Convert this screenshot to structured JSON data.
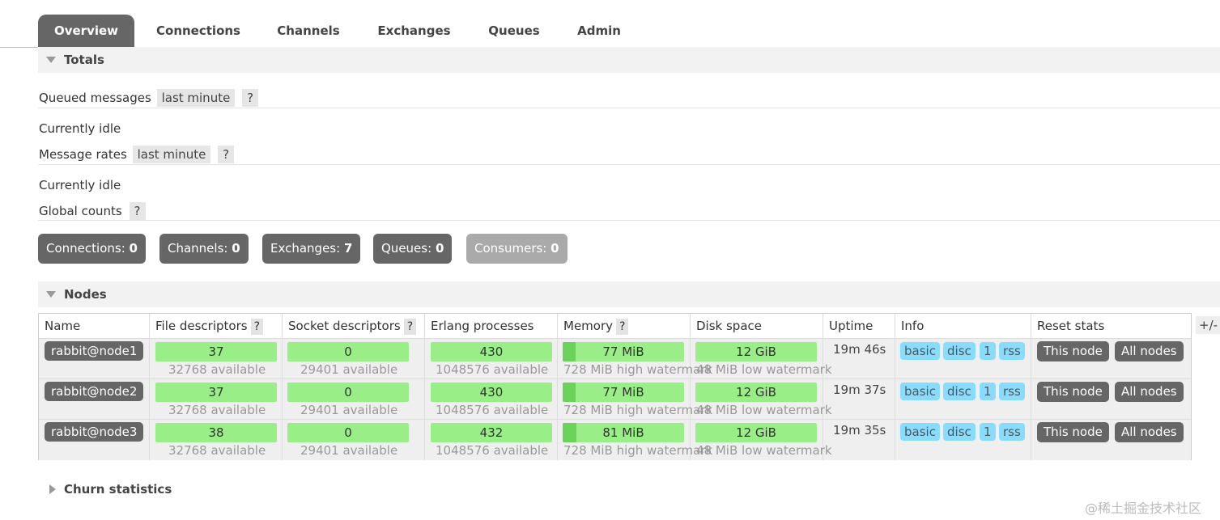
{
  "tabs": [
    "Overview",
    "Connections",
    "Channels",
    "Exchanges",
    "Queues",
    "Admin"
  ],
  "totals": {
    "title": "Totals",
    "queued_label": "Queued messages",
    "queued_period": "last minute",
    "queued_help": "?",
    "queued_status": "Currently idle",
    "rates_label": "Message rates",
    "rates_period": "last minute",
    "rates_help": "?",
    "rates_status": "Currently idle",
    "global_label": "Global counts",
    "global_help": "?"
  },
  "counts": [
    {
      "label": "Connections:",
      "value": "0"
    },
    {
      "label": "Channels:",
      "value": "0"
    },
    {
      "label": "Exchanges:",
      "value": "7"
    },
    {
      "label": "Queues:",
      "value": "0"
    },
    {
      "label": "Consumers:",
      "value": "0"
    }
  ],
  "nodes": {
    "title": "Nodes",
    "toggle": "+/-",
    "columns": {
      "name": "Name",
      "fd": "File descriptors",
      "sd": "Socket descriptors",
      "erl": "Erlang processes",
      "mem": "Memory",
      "disk": "Disk space",
      "uptime": "Uptime",
      "info": "Info",
      "reset": "Reset stats",
      "help": "?"
    },
    "info_tags": [
      "basic",
      "disc",
      "1",
      "rss"
    ],
    "reset_buttons": [
      "This node",
      "All nodes"
    ],
    "rows": [
      {
        "name": "rabbit@node1",
        "fd": "37",
        "fd_avail": "32768 available",
        "sd": "0",
        "sd_avail": "29401 available",
        "erl": "430",
        "erl_avail": "1048576 available",
        "mem": "77 MiB",
        "mem_sub": "728 MiB high watermark",
        "disk": "12 GiB",
        "disk_sub": "48 MiB low watermark",
        "uptime": "19m 46s"
      },
      {
        "name": "rabbit@node2",
        "fd": "37",
        "fd_avail": "32768 available",
        "sd": "0",
        "sd_avail": "29401 available",
        "erl": "430",
        "erl_avail": "1048576 available",
        "mem": "77 MiB",
        "mem_sub": "728 MiB high watermark",
        "disk": "12 GiB",
        "disk_sub": "48 MiB low watermark",
        "uptime": "19m 37s"
      },
      {
        "name": "rabbit@node3",
        "fd": "38",
        "fd_avail": "32768 available",
        "sd": "0",
        "sd_avail": "29401 available",
        "erl": "432",
        "erl_avail": "1048576 available",
        "mem": "81 MiB",
        "mem_sub": "728 MiB high watermark",
        "disk": "12 GiB",
        "disk_sub": "48 MiB low watermark",
        "uptime": "19m 35s"
      }
    ]
  },
  "churn": {
    "title": "Churn statistics"
  },
  "watermark": "@稀土掘金技术社区"
}
